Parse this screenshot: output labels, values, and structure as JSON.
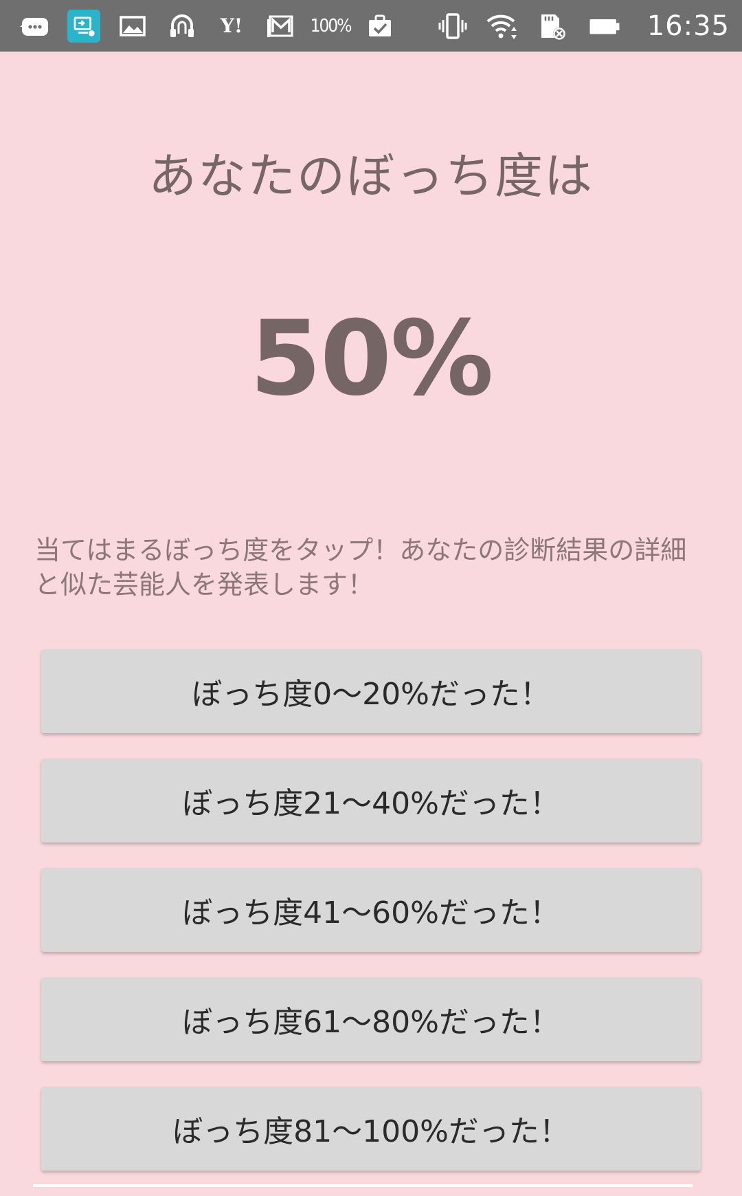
{
  "status_bar": {
    "time": "16:35",
    "left_icons": [
      "chat-bubble-icon",
      "screen-mirror-app-icon",
      "gallery-icon",
      "headset-icon",
      "yahoo-icon",
      "gmail-icon",
      "hundred-percent-icon",
      "clipboard-check-icon"
    ],
    "yahoo_text": "Y!",
    "hundred_text": "100%",
    "right_icons": [
      "vibrate-icon",
      "wifi-icon",
      "sd-card-icon",
      "battery-icon"
    ]
  },
  "result": {
    "heading": "あなたのぼっち度は",
    "percent": "50%"
  },
  "instruction": "当てはまるぼっち度をタップ！あなたの診断結果の詳細と似た芸能人を発表します！",
  "buttons": [
    {
      "label": "ぼっち度0〜20%だった！"
    },
    {
      "label": "ぼっち度21〜40%だった！"
    },
    {
      "label": "ぼっち度41〜60%だった！"
    },
    {
      "label": "ぼっち度61〜80%だった！"
    },
    {
      "label": "ぼっち度81〜100%だった！"
    }
  ],
  "colors": {
    "background": "#f9d9de",
    "status_bar": "#6f6f6f",
    "button": "#d8d8d8",
    "heading_text": "#776666"
  }
}
